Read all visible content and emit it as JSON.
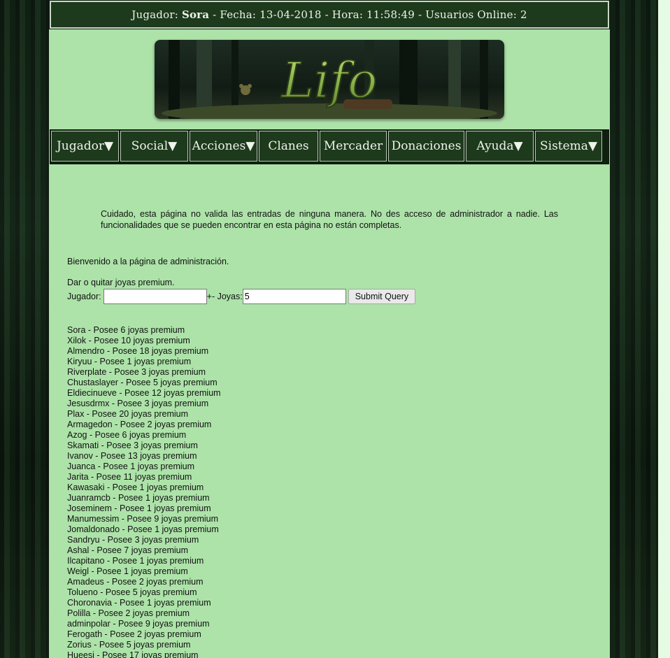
{
  "header": {
    "player_label": "Jugador:",
    "player_name": "Sora",
    "date_label": "- Fecha:",
    "date_value": "13-04-2018",
    "time_label": "- Hora:",
    "time_value": "11:58:49",
    "online_label": "- Usuarios Online:",
    "online_value": "2"
  },
  "banner": {
    "logo_text": "Lifo"
  },
  "nav": [
    {
      "label": "Jugador▼"
    },
    {
      "label": "Social▼"
    },
    {
      "label": "Acciones▼"
    },
    {
      "label": "Clanes"
    },
    {
      "label": "Mercader"
    },
    {
      "label": "Donaciones"
    },
    {
      "label": "Ayuda▼"
    },
    {
      "label": "Sistema▼"
    }
  ],
  "warning_text": "Cuidado, esta página no valida las entradas de ninguna manera. No des acceso de administrador a nadie. Las funcionalidades que se pueden encontrar en esta página no están completas.",
  "welcome_text": "Bienvenido a la página de administración.",
  "premium_form": {
    "title": "Dar o quitar joyas premium.",
    "player_label": "Jugador:",
    "player_value": "",
    "amount_label": "+- Joyas:",
    "amount_value": "5",
    "submit_label": "Submit Query"
  },
  "players": [
    "Sora - Posee 6 joyas premium",
    "Xilok - Posee 10 joyas premium",
    "Almendro - Posee 18 joyas premium",
    "Kiryuu - Posee 1 joyas premium",
    "Riverplate - Posee 3 joyas premium",
    "Chustaslayer - Posee 5 joyas premium",
    "Eldiecinueve - Posee 12 joyas premium",
    "Jesusdrmx - Posee 3 joyas premium",
    "Plax - Posee 20 joyas premium",
    "Armagedon - Posee 2 joyas premium",
    "Azog - Posee 6 joyas premium",
    "Skamati - Posee 3 joyas premium",
    "Ivanov - Posee 13 joyas premium",
    "Juanca - Posee 1 joyas premium",
    "Jarita - Posee 11 joyas premium",
    "Kawasaki - Posee 1 joyas premium",
    "Juanramcb - Posee 1 joyas premium",
    "Joseminem - Posee 1 joyas premium",
    "Manumessim - Posee 9 joyas premium",
    "Jomaldonado - Posee 1 joyas premium",
    "Sandryu - Posee 3 joyas premium",
    "Ashal - Posee 7 joyas premium",
    "Ilcapitano - Posee 1 joyas premium",
    "Weigl - Posee 1 joyas premium",
    "Amadeus - Posee 2 joyas premium",
    "Tolueno - Posee 5 joyas premium",
    "Choronavia - Posee 1 joyas premium",
    "Polilla - Posee 2 joyas premium",
    "adminpolar - Posee 9 joyas premium",
    "Ferogath - Posee 2 joyas premium",
    "Zorius - Posee 5 joyas premium",
    "Hueesi - Posee 17 joyas premium"
  ]
}
